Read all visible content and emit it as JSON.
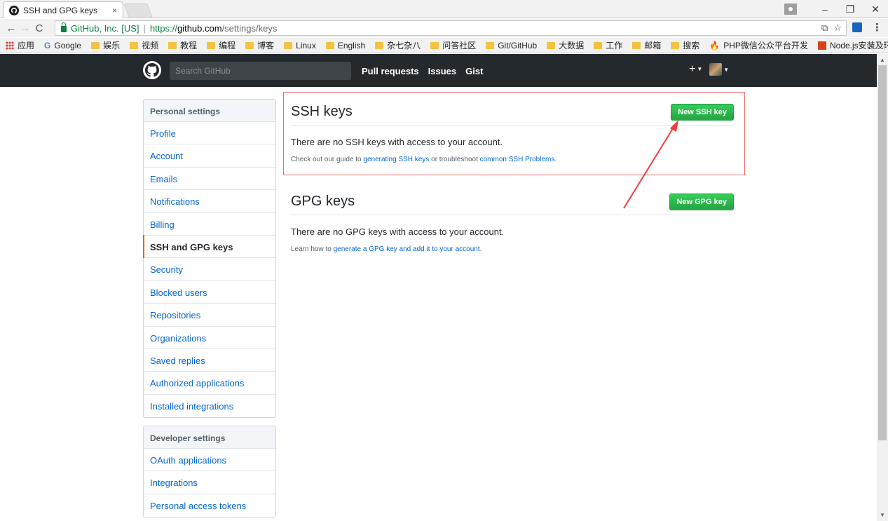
{
  "browser": {
    "tab_title": "SSH and GPG keys",
    "tab_close": "×",
    "secure_label": "GitHub, Inc. [US]",
    "url_separator": "|",
    "url_scheme": "https://",
    "url_host": "github.com",
    "url_path": "/settings/keys",
    "window_controls": [
      "–",
      "❐",
      "✕"
    ],
    "bookmarks": [
      {
        "label": "应用",
        "icon": "apps-grid-icon"
      },
      {
        "label": "Google",
        "icon": "google-icon"
      },
      {
        "label": "娱乐",
        "icon": "folder-icon"
      },
      {
        "label": "视频",
        "icon": "folder-icon"
      },
      {
        "label": "教程",
        "icon": "folder-icon"
      },
      {
        "label": "编程",
        "icon": "folder-icon"
      },
      {
        "label": "博客",
        "icon": "folder-icon"
      },
      {
        "label": "Linux",
        "icon": "folder-icon"
      },
      {
        "label": "English",
        "icon": "folder-icon"
      },
      {
        "label": "杂七杂八",
        "icon": "folder-icon"
      },
      {
        "label": "问答社区",
        "icon": "folder-icon"
      },
      {
        "label": "Git/GitHub",
        "icon": "folder-icon"
      },
      {
        "label": "大数据",
        "icon": "folder-icon"
      },
      {
        "label": "工作",
        "icon": "folder-icon"
      },
      {
        "label": "邮箱",
        "icon": "folder-icon"
      },
      {
        "label": "搜索",
        "icon": "folder-icon"
      },
      {
        "label": "PHP微信公众平台开发",
        "icon": "flame-icon"
      },
      {
        "label": "Node.js安装及环境配",
        "icon": "page-icon"
      }
    ],
    "bookmarks_more": "»"
  },
  "github_header": {
    "search_placeholder": "Search GitHub",
    "nav": [
      "Pull requests",
      "Issues",
      "Gist"
    ],
    "plus": "+"
  },
  "sidebar": {
    "personal": {
      "heading": "Personal settings",
      "items": [
        {
          "label": "Profile",
          "selected": false
        },
        {
          "label": "Account",
          "selected": false
        },
        {
          "label": "Emails",
          "selected": false
        },
        {
          "label": "Notifications",
          "selected": false
        },
        {
          "label": "Billing",
          "selected": false
        },
        {
          "label": "SSH and GPG keys",
          "selected": true
        },
        {
          "label": "Security",
          "selected": false
        },
        {
          "label": "Blocked users",
          "selected": false
        },
        {
          "label": "Repositories",
          "selected": false
        },
        {
          "label": "Organizations",
          "selected": false
        },
        {
          "label": "Saved replies",
          "selected": false
        },
        {
          "label": "Authorized applications",
          "selected": false
        },
        {
          "label": "Installed integrations",
          "selected": false
        }
      ]
    },
    "developer": {
      "heading": "Developer settings",
      "items": [
        {
          "label": "OAuth applications"
        },
        {
          "label": "Integrations"
        },
        {
          "label": "Personal access tokens"
        }
      ]
    }
  },
  "ssh": {
    "title": "SSH keys",
    "button": "New SSH key",
    "blank_message": "There are no SSH keys with access to your account.",
    "help_prefix": "Check out our guide to ",
    "help_link1": "generating SSH keys",
    "help_middle": " or troubleshoot ",
    "help_link2": "common SSH Problems",
    "help_suffix": "."
  },
  "gpg": {
    "title": "GPG keys",
    "button": "New GPG key",
    "blank_message": "There are no GPG keys with access to your account.",
    "help_prefix": "Learn how to ",
    "help_link": "generate a GPG key and add it to your account",
    "help_suffix": "."
  },
  "colors": {
    "header_bg": "#24292e",
    "link": "#0366d6",
    "green_button": "#28a745",
    "selected_accent": "#e36209",
    "annotation_red": "#f03c3c"
  }
}
